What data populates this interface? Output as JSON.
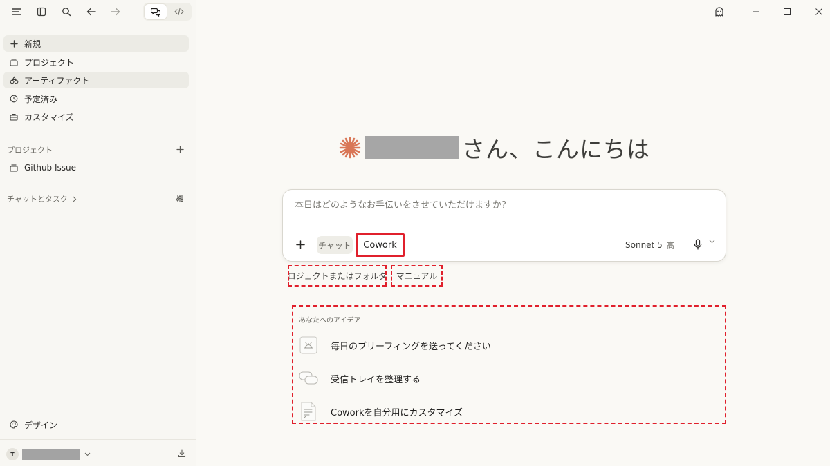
{
  "sidebar": {
    "nav": [
      {
        "label": "新規",
        "icon": "plus-icon"
      },
      {
        "label": "プロジェクト",
        "icon": "folder-icon"
      },
      {
        "label": "アーティファクト",
        "icon": "artifacts-icon"
      },
      {
        "label": "予定済み",
        "icon": "clock-icon"
      },
      {
        "label": "カスタマイズ",
        "icon": "briefcase-icon"
      }
    ],
    "projects_label": "プロジェクト",
    "projects": [
      {
        "label": "Github Issue"
      }
    ],
    "chats_label": "チャットとタスク",
    "bottom_item": "デザイン",
    "user_initial": "T"
  },
  "toolbar": {
    "mode_chat_icon": "chat-bubbles-icon",
    "mode_code_icon": "code-icon"
  },
  "main": {
    "greeting_suffix": "さん、こんにちは",
    "composer": {
      "placeholder": "本日はどのようなお手伝いをさせていただけますか？",
      "chip_chat": "チャット",
      "chip_cowork": "Cowork",
      "model": "Sonnet 5",
      "effort": "高"
    },
    "tags": [
      "プロジェクトまたはフォルダー",
      "マニュアル"
    ],
    "ideas_label": "あなたへのアイデア",
    "ideas": [
      {
        "label": "毎日のブリーフィングを送ってください",
        "icon": "bell-icon"
      },
      {
        "label": "受信トレイを整理する",
        "icon": "inbox-chat-icon"
      },
      {
        "label": "Coworkを自分用にカスタマイズ",
        "icon": "document-icon"
      }
    ]
  },
  "colors": {
    "accent": "#d97757",
    "highlight_box": "#e0202c",
    "background": "#faf9f5"
  }
}
